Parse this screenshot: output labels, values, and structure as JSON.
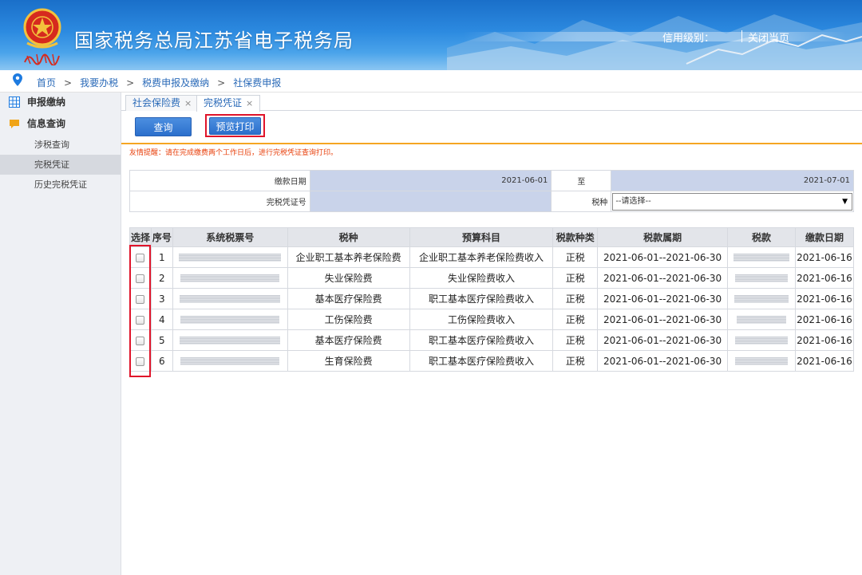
{
  "header": {
    "title": "国家税务总局江苏省电子税务局",
    "credit_label": "信用级别：",
    "close_label": "关闭当页",
    "brand_color": "#2c8ae0"
  },
  "breadcrumb": {
    "icon": "location-pin-icon",
    "items": [
      "首页",
      "我要办税",
      "税费申报及缴纳",
      "社保费申报"
    ],
    "separator": ">"
  },
  "sidebar": {
    "groups": [
      {
        "label": "申报缴纳",
        "icon": "grid-icon"
      },
      {
        "label": "信息查询",
        "icon": "chat-icon"
      }
    ],
    "items": [
      {
        "label": "涉税查询",
        "active": false
      },
      {
        "label": "完税凭证",
        "active": true
      },
      {
        "label": "历史完税凭证",
        "active": false
      }
    ]
  },
  "tabs": [
    {
      "label": "社会保险费",
      "close": "×",
      "active": false
    },
    {
      "label": "完税凭证",
      "close": "×",
      "active": true
    }
  ],
  "toolbar": {
    "query_label": "查询",
    "print_label": "预览打印"
  },
  "notice": "友情提醒：请在完成缴费两个工作日后，进行完税凭证查询打印。",
  "filter": {
    "pay_date_label": "缴款日期",
    "pay_date_from": "2021-06-01",
    "to_label": "至",
    "pay_date_to": "2021-07-01",
    "voucher_label": "完税凭证号",
    "voucher_value": "",
    "tax_type_label": "税种",
    "tax_type_selected": "--请选择--"
  },
  "table": {
    "headers": [
      "选择",
      "序号",
      "系统税票号",
      "税种",
      "预算科目",
      "税款种类",
      "税款属期",
      "税款",
      "缴款日期"
    ],
    "rows": [
      {
        "no": "1",
        "tax": "企业职工基本养老保险费",
        "budget": "企业职工基本养老保险费收入",
        "kind": "正税",
        "period": "2021-06-01--2021-06-30",
        "date": "2021-06-16"
      },
      {
        "no": "2",
        "tax": "失业保险费",
        "budget": "失业保险费收入",
        "kind": "正税",
        "period": "2021-06-01--2021-06-30",
        "date": "2021-06-16"
      },
      {
        "no": "3",
        "tax": "基本医疗保险费",
        "budget": "职工基本医疗保险费收入",
        "kind": "正税",
        "period": "2021-06-01--2021-06-30",
        "date": "2021-06-16"
      },
      {
        "no": "4",
        "tax": "工伤保险费",
        "budget": "工伤保险费收入",
        "kind": "正税",
        "period": "2021-06-01--2021-06-30",
        "date": "2021-06-16"
      },
      {
        "no": "5",
        "tax": "基本医疗保险费",
        "budget": "职工基本医疗保险费收入",
        "kind": "正税",
        "period": "2021-06-01--2021-06-30",
        "date": "2021-06-16"
      },
      {
        "no": "6",
        "tax": "生育保险费",
        "budget": "职工基本医疗保险费收入",
        "kind": "正税",
        "period": "2021-06-01--2021-06-30",
        "date": "2021-06-16"
      }
    ]
  }
}
